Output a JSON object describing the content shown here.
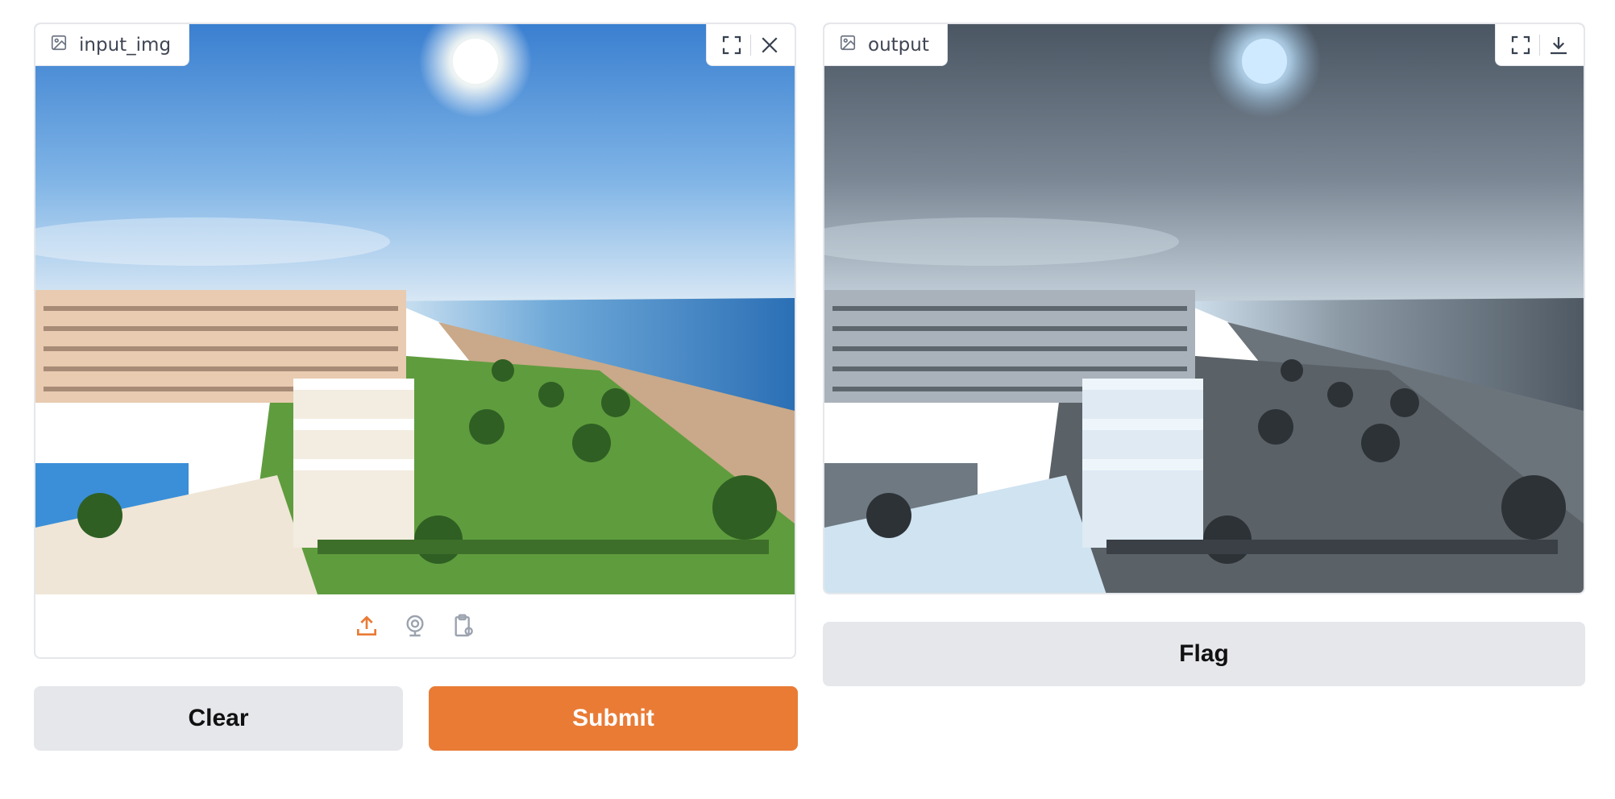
{
  "input_panel": {
    "label": "input_img",
    "icons": [
      "image-icon",
      "fullscreen-icon",
      "close-icon"
    ],
    "sources": [
      "upload-icon",
      "webcam-icon",
      "clipboard-icon"
    ],
    "accent": "#e97b35"
  },
  "output_panel": {
    "label": "output",
    "icons": [
      "image-icon",
      "fullscreen-icon",
      "download-icon"
    ]
  },
  "buttons": {
    "clear": "Clear",
    "submit": "Submit",
    "flag": "Flag"
  },
  "colors": {
    "primary": "#e97b35",
    "secondary": "#e5e7eb",
    "border": "#e5e7eb"
  }
}
